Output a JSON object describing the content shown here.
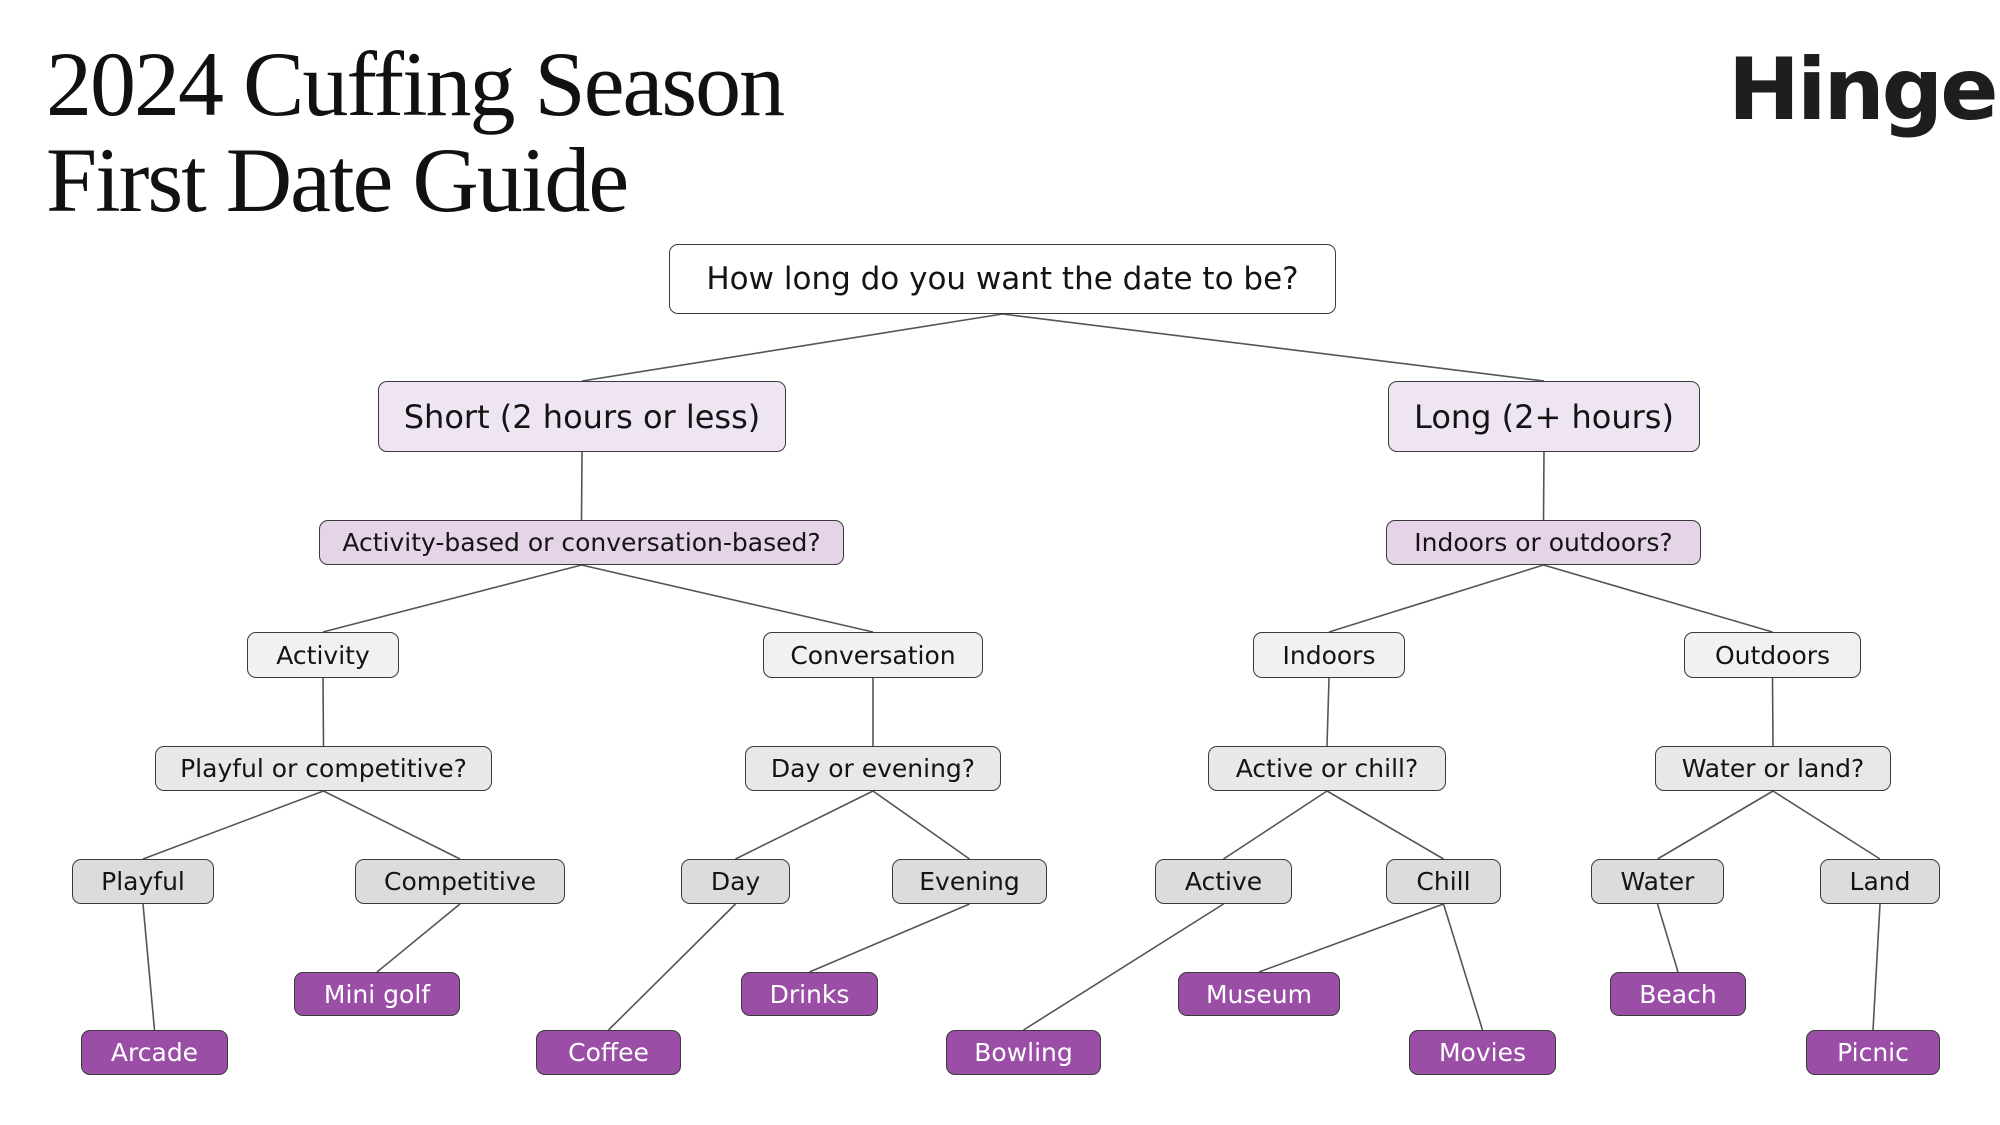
{
  "header": {
    "title_line1": "2024 Cuffing Season",
    "title_line2": "First Date Guide",
    "brand": "Hinge"
  },
  "colors": {
    "leaf_purple": "#9a4ea6",
    "duration_fill": "#efe4f2",
    "question_purple_fill": "#e5d3e8",
    "choice_fill": "#f1f1f1",
    "option_fill": "#dcdcdc",
    "edge": "#555555"
  },
  "tree": {
    "root": "How long do you want the date to be?",
    "short": "Short (2 hours or less)",
    "long": "Long (2+ hours)",
    "q_activity_conversation": "Activity-based or conversation-based?",
    "q_indoors_outdoors": "Indoors or outdoors?",
    "activity": "Activity",
    "conversation": "Conversation",
    "indoors": "Indoors",
    "outdoors": "Outdoors",
    "q_playful_competitive": "Playful or competitive?",
    "q_day_evening": "Day or evening?",
    "q_active_chill": "Active or chill?",
    "q_water_land": "Water or land?",
    "playful": "Playful",
    "competitive": "Competitive",
    "day": "Day",
    "evening": "Evening",
    "active": "Active",
    "chill": "Chill",
    "water": "Water",
    "land": "Land",
    "arcade": "Arcade",
    "mini_golf": "Mini golf",
    "coffee": "Coffee",
    "drinks": "Drinks",
    "bowling": "Bowling",
    "museum": "Museum",
    "movies": "Movies",
    "beach": "Beach",
    "picnic": "Picnic"
  },
  "edges": [
    [
      "root",
      "short"
    ],
    [
      "root",
      "long"
    ],
    [
      "short",
      "q_activity_conversation"
    ],
    [
      "long",
      "q_indoors_outdoors"
    ],
    [
      "q_activity_conversation",
      "activity"
    ],
    [
      "q_activity_conversation",
      "conversation"
    ],
    [
      "q_indoors_outdoors",
      "indoors"
    ],
    [
      "q_indoors_outdoors",
      "outdoors"
    ],
    [
      "activity",
      "q_playful_competitive"
    ],
    [
      "conversation",
      "q_day_evening"
    ],
    [
      "indoors",
      "q_active_chill"
    ],
    [
      "outdoors",
      "q_water_land"
    ],
    [
      "q_playful_competitive",
      "playful"
    ],
    [
      "q_playful_competitive",
      "competitive"
    ],
    [
      "q_day_evening",
      "day"
    ],
    [
      "q_day_evening",
      "evening"
    ],
    [
      "q_active_chill",
      "active"
    ],
    [
      "q_active_chill",
      "chill"
    ],
    [
      "q_water_land",
      "water"
    ],
    [
      "q_water_land",
      "land"
    ],
    [
      "playful",
      "arcade"
    ],
    [
      "competitive",
      "mini_golf"
    ],
    [
      "day",
      "coffee"
    ],
    [
      "evening",
      "drinks"
    ],
    [
      "active",
      "bowling"
    ],
    [
      "chill",
      "museum"
    ],
    [
      "chill",
      "movies"
    ],
    [
      "water",
      "beach"
    ],
    [
      "land",
      "picnic"
    ]
  ]
}
